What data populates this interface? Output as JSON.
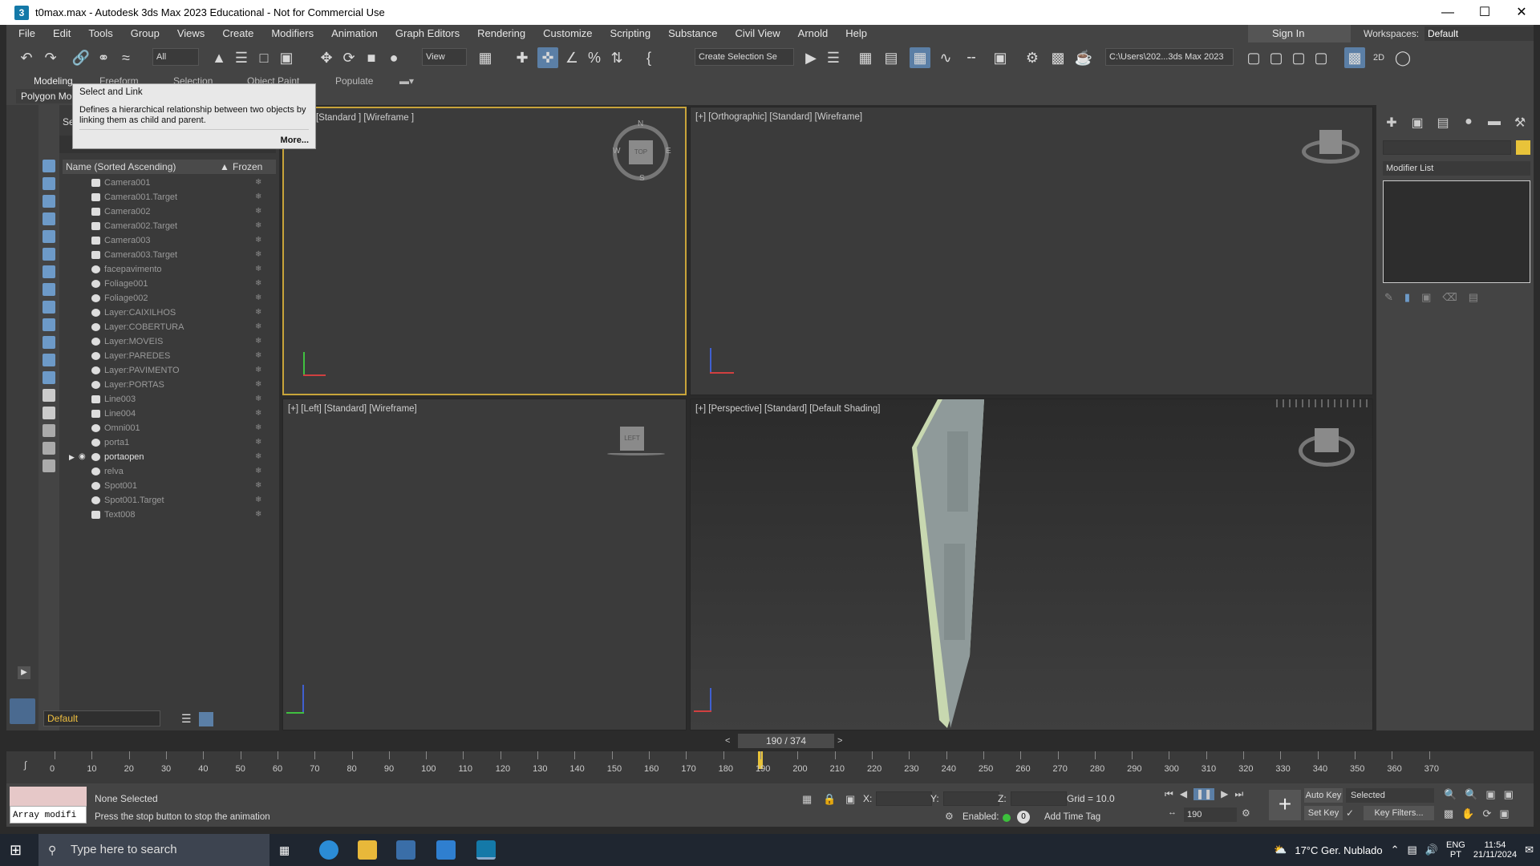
{
  "window": {
    "title": "t0max.max - Autodesk 3ds Max 2023 Educational - Not for Commercial Use",
    "app_icon": "3",
    "minimize": "—",
    "maximize": "☐",
    "close": "✕"
  },
  "menubar": {
    "items": [
      "File",
      "Edit",
      "Tools",
      "Group",
      "Views",
      "Create",
      "Modifiers",
      "Animation",
      "Graph Editors",
      "Rendering",
      "Customize",
      "Scripting",
      "Substance",
      "Civil View",
      "Arnold",
      "Help"
    ],
    "sign_in": "Sign In",
    "workspaces_label": "Workspaces:",
    "workspace_value": "Default"
  },
  "toolbar": {
    "filter_value": "All",
    "view_value": "View",
    "selection_set": "Create Selection Se",
    "project_path": "C:\\Users\\202...3ds Max 2023",
    "snap_value": "2D"
  },
  "ribbon": {
    "tabs": [
      "Modeling",
      "Freeform",
      "Selection",
      "Object Paint",
      "Populate"
    ],
    "sub_label": "Polygon Mo"
  },
  "tooltip": {
    "title": "Select and Link",
    "body": "Defines a hierarchical relationship between two objects by linking them as child and parent.",
    "more": "More..."
  },
  "explorer": {
    "tab_label": "Sele",
    "col_name": "Name (Sorted Ascending)",
    "col_frozen": "Frozen",
    "rows": [
      {
        "name": "Camera001",
        "icon": "camera-icon"
      },
      {
        "name": "Camera001.Target",
        "icon": "camera-icon"
      },
      {
        "name": "Camera002",
        "icon": "camera-icon"
      },
      {
        "name": "Camera002.Target",
        "icon": "camera-icon"
      },
      {
        "name": "Camera003",
        "icon": "camera-icon"
      },
      {
        "name": "Camera003.Target",
        "icon": "camera-icon"
      },
      {
        "name": "facepavimento",
        "icon": "sphere-icon"
      },
      {
        "name": "Foliage001",
        "icon": "sphere-icon"
      },
      {
        "name": "Foliage002",
        "icon": "sphere-icon"
      },
      {
        "name": "Layer:CAIXILHOS",
        "icon": "sphere-icon"
      },
      {
        "name": "Layer:COBERTURA",
        "icon": "sphere-icon"
      },
      {
        "name": "Layer:MOVEIS",
        "icon": "sphere-icon"
      },
      {
        "name": "Layer:PAREDES",
        "icon": "sphere-icon"
      },
      {
        "name": "Layer:PAVIMENTO",
        "icon": "sphere-icon"
      },
      {
        "name": "Layer:PORTAS",
        "icon": "sphere-icon"
      },
      {
        "name": "Line003",
        "icon": "shape-icon"
      },
      {
        "name": "Line004",
        "icon": "shape-icon"
      },
      {
        "name": "Omni001",
        "icon": "light-icon"
      },
      {
        "name": "porta1",
        "icon": "light-icon"
      },
      {
        "name": "portaopen",
        "icon": "sphere-icon",
        "selected": true
      },
      {
        "name": "relva",
        "icon": "sphere-icon"
      },
      {
        "name": "Spot001",
        "icon": "light-icon"
      },
      {
        "name": "Spot001.Target",
        "icon": "light-icon"
      },
      {
        "name": "Text008",
        "icon": "shape-icon"
      }
    ],
    "frozen_glyph": "❄",
    "layer_value": "Default"
  },
  "viewports": {
    "top": "[+] [Top] [Standard] [Wireframe]",
    "top_visible": "p ] [Standard ] [Wireframe ]",
    "ortho": "[+] [Orthographic] [Standard] [Wireframe]",
    "left": "[+] [Left] [Standard] [Wireframe]",
    "persp": "[+] [Perspective] [Standard] [Default Shading]",
    "viewcube_top": "TOP",
    "viewcube_left": "LEFT",
    "compass_n": "N",
    "compass_s": "S",
    "compass_e": "E",
    "compass_w": "W"
  },
  "cmdpanel": {
    "modifier_list": "Modifier List",
    "accent": "#e8c33a"
  },
  "timeline": {
    "slider_label": "190 / 374",
    "current_frame": 190,
    "total_frames": 374,
    "ticks": [
      0,
      10,
      20,
      30,
      40,
      50,
      60,
      70,
      80,
      90,
      100,
      110,
      120,
      130,
      140,
      150,
      160,
      170,
      180,
      190,
      200,
      210,
      220,
      230,
      240,
      250,
      260,
      270,
      280,
      290,
      300,
      310,
      320,
      330,
      340,
      350,
      360,
      370
    ]
  },
  "status": {
    "selection": "None Selected",
    "hint": "Press the stop button to stop the animation",
    "maxscript": "Array modifi",
    "x_label": "X:",
    "y_label": "Y:",
    "z_label": "Z:",
    "grid": "Grid = 10.0",
    "enabled": "Enabled:",
    "add_time_tag": "Add Time Tag",
    "auto_key": "Auto Key",
    "set_key": "Set Key",
    "key_mode": "Selected",
    "key_filters": "Key Filters...",
    "frame_field": "190"
  },
  "taskbar": {
    "search_placeholder": "Type here to search",
    "weather": "17°C  Ger. Nublado",
    "lang": "ENG",
    "region": "PT",
    "time": "11:54",
    "date": "21/11/2024"
  }
}
